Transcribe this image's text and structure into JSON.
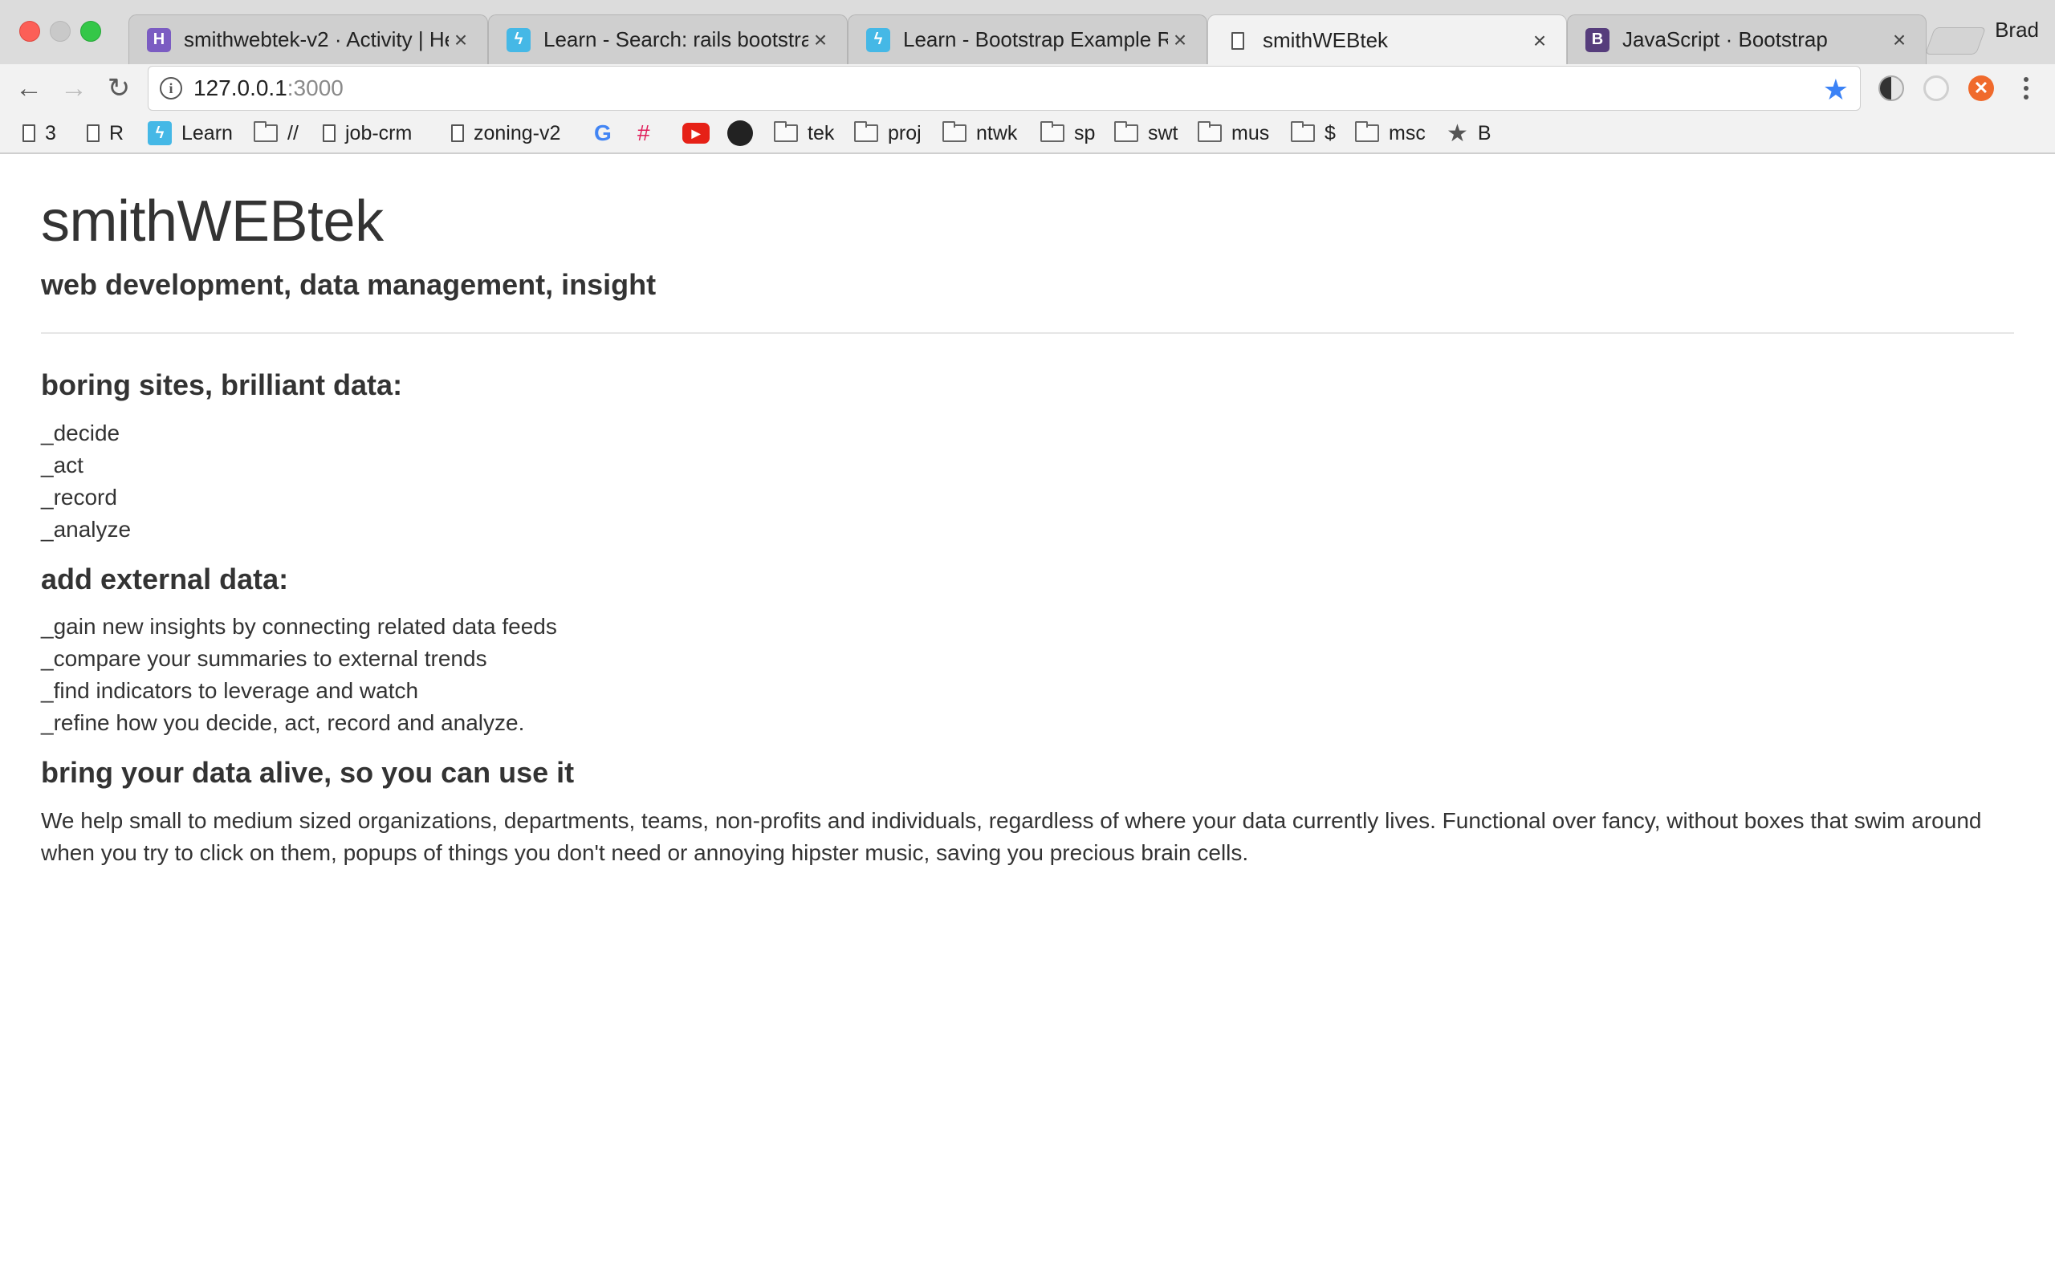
{
  "browser": {
    "tabs": [
      {
        "title": "smithwebtek-v2 · Activity | He",
        "favicon": "heroku-icon",
        "fav_color": "#7b5cc2",
        "fav_char": "H"
      },
      {
        "title": "Learn - Search: rails bootstrap",
        "favicon": "learn-icon",
        "fav_color": "#45b8e6",
        "fav_char": "ϟ"
      },
      {
        "title": "Learn - Bootstrap Example Ra",
        "favicon": "learn-icon",
        "fav_color": "#45b8e6",
        "fav_char": "ϟ"
      },
      {
        "title": "smithWEBtek",
        "favicon": "page-icon",
        "active": true
      },
      {
        "title": "JavaScript · Bootstrap",
        "favicon": "bootstrap-icon",
        "fav_color": "#563d7c",
        "fav_char": "B"
      }
    ],
    "profile_name": "Brad",
    "url_host": "127.0.0.1",
    "url_port": ":3000",
    "bookmarks": [
      {
        "label": "3",
        "icon": "page-icon"
      },
      {
        "label": "R",
        "icon": "page-icon"
      },
      {
        "label": "Learn",
        "icon": "learn-icon"
      },
      {
        "label": "//",
        "icon": "folder-icon"
      },
      {
        "label": "job-crm",
        "icon": "page-icon"
      },
      {
        "label": "zoning-v2",
        "icon": "page-icon"
      },
      {
        "label": "",
        "icon": "google-icon"
      },
      {
        "label": "",
        "icon": "slack-icon"
      },
      {
        "label": "",
        "icon": "youtube-icon"
      },
      {
        "label": "",
        "icon": "github-icon"
      },
      {
        "label": "tek",
        "icon": "folder-icon"
      },
      {
        "label": "proj",
        "icon": "folder-icon"
      },
      {
        "label": "ntwk",
        "icon": "folder-icon"
      },
      {
        "label": "sp",
        "icon": "folder-icon"
      },
      {
        "label": "swt",
        "icon": "folder-icon"
      },
      {
        "label": "mus",
        "icon": "folder-icon"
      },
      {
        "label": "$",
        "icon": "folder-icon"
      },
      {
        "label": "msc",
        "icon": "folder-icon"
      },
      {
        "label": "B",
        "icon": "star-icon"
      }
    ]
  },
  "page": {
    "title": "smithWEBtek",
    "subtitle": "web development, data management, insight",
    "sections": [
      {
        "heading": "boring sites, brilliant data:",
        "lines": [
          "_decide",
          "_act",
          "_record",
          "_analyze"
        ]
      },
      {
        "heading": "add external data:",
        "lines": [
          "_gain new insights by connecting related data feeds",
          "_compare your summaries to external trends",
          "_find indicators to leverage and watch",
          "_refine how you decide, act, record and analyze."
        ]
      },
      {
        "heading": "bring your data alive, so you can use it",
        "paragraph": "We help small to medium sized organizations, departments, teams, non-profits and individuals, regardless of where your data currently lives. Functional over fancy, without boxes that swim around when you try to click on them, popups of things you don't need or annoying hipster music, saving you precious brain cells."
      }
    ]
  }
}
